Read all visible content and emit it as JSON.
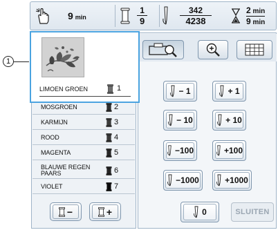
{
  "callout": {
    "number": "1"
  },
  "status": {
    "time_value": "9",
    "time_unit": "min",
    "color_fraction": {
      "numerator": "1",
      "denominator": "9"
    },
    "stitch_fraction": {
      "numerator": "342",
      "denominator": "4238"
    },
    "remaining": {
      "top_value": "2",
      "top_unit": "min",
      "bottom_value": "9",
      "bottom_unit": "min"
    }
  },
  "colors": [
    {
      "name": "LIMOEN GROEN",
      "index": "1",
      "spool_color": "#6f6f6f"
    },
    {
      "name": "MOSGROEN",
      "index": "2",
      "spool_color": "#2f2f2f"
    },
    {
      "name": "KARMIJN",
      "index": "3",
      "spool_color": "#3c3c3c"
    },
    {
      "name": "ROOD",
      "index": "4",
      "spool_color": "#3a3a3a"
    },
    {
      "name": "MAGENTA",
      "index": "5",
      "spool_color": "#262626"
    },
    {
      "name": "BLAUWE REGEN PAARS",
      "index": "6",
      "spool_color": "#242424"
    },
    {
      "name": "VIOLET",
      "index": "7",
      "spool_color": "#0a0a0a"
    }
  ],
  "left_buttons": {
    "minus": "−",
    "plus": "+"
  },
  "step_buttons": [
    {
      "label": "− 1",
      "name": "back-1-button"
    },
    {
      "label": "+ 1",
      "name": "forward-1-button"
    },
    {
      "label": "− 10",
      "name": "back-10-button"
    },
    {
      "label": "+ 10",
      "name": "forward-10-button"
    },
    {
      "label": "−100",
      "name": "back-100-button"
    },
    {
      "label": "+100",
      "name": "forward-100-button"
    },
    {
      "label": "−1000",
      "name": "back-1000-button"
    },
    {
      "label": "+1000",
      "name": "forward-1000-button"
    }
  ],
  "zero_button": "0",
  "close_button": "SLUITEN"
}
